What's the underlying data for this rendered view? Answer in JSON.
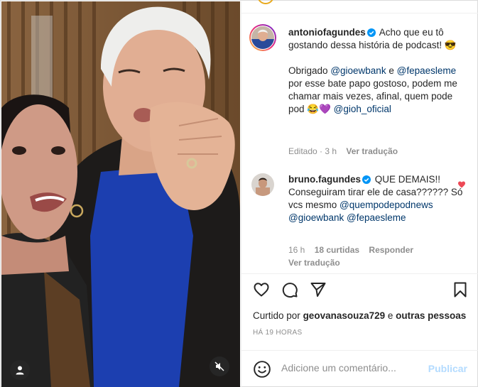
{
  "post": {
    "caption": {
      "username": "antoniofagundes",
      "text_1": "Acho que eu tô gostando dessa história de podcast! 😎",
      "text_2": "Obrigado",
      "mention_1": "@gioewbank",
      "text_3": "e",
      "mention_2": "@fepaesleme",
      "text_4": "por esse bate papo gostoso, podem me chamar mais vezes, afinal, quem pode pod 😂💜",
      "mention_3": "@gioh_oficial",
      "edited": "Editado · 3 h",
      "translate": "Ver tradução"
    },
    "comment": {
      "username": "bruno.fagundes",
      "text_1": "QUE DEMAIS!! Conseguiram tirar ele de casa?????? Só vcs mesmo",
      "mention_1": "@quempodepodnews",
      "mention_2": "@gioewbank",
      "mention_3": "@fepaesleme",
      "time": "16 h",
      "likes": "18 curtidas",
      "reply": "Responder",
      "translate": "Ver tradução"
    },
    "liked_by": {
      "prefix": "Curtido por",
      "user": "geovanasouza729",
      "middle": "e",
      "others": "outras pessoas"
    },
    "timestamp": "HÁ 19 HORAS",
    "add_comment": {
      "placeholder": "Adicione um comentário...",
      "publish": "Publicar"
    }
  },
  "icons": {
    "like": "heart-icon",
    "comment": "comment-icon",
    "share": "send-icon",
    "save": "bookmark-icon",
    "emoji": "smiley-icon",
    "user_tag": "user-icon",
    "mute": "speaker-muted-icon",
    "verified": "verified-badge-icon"
  },
  "colors": {
    "mention": "#00376b",
    "verified": "#0095f6",
    "heart_liked": "#ed4956",
    "publish_disabled": "#b3dbff",
    "muted_text": "#8e8e8e"
  }
}
